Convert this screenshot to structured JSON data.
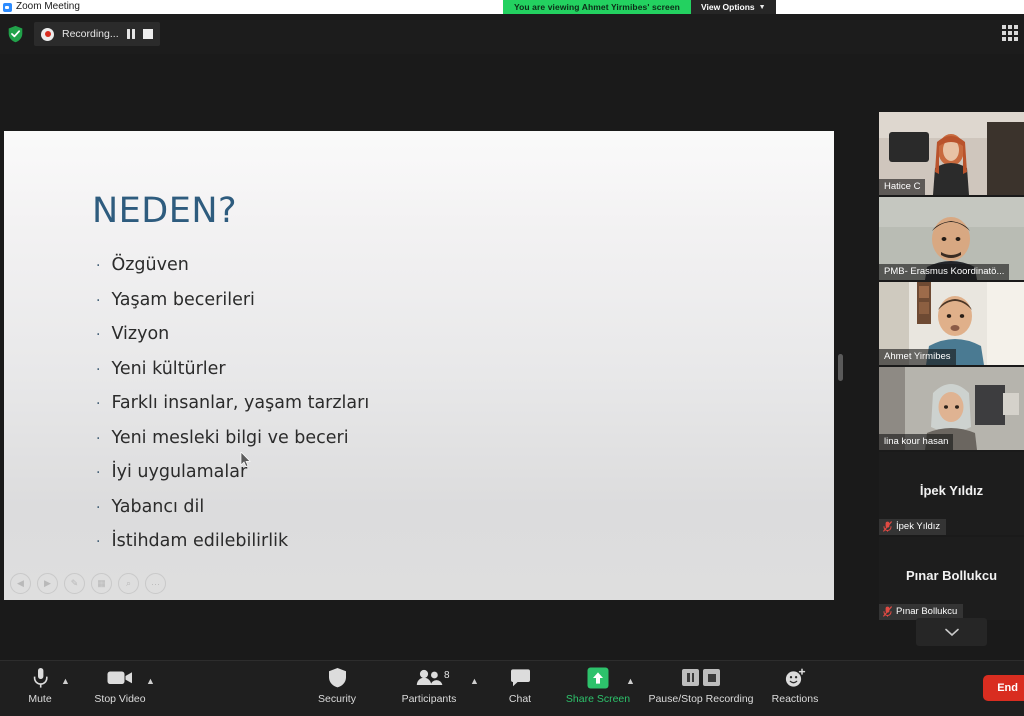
{
  "window": {
    "app_icon": "zoom-icon",
    "title": "Zoom Meeting"
  },
  "share_banner": {
    "viewing_text": "You are viewing Ahmet Yirmibes' screen",
    "view_options_label": "View Options",
    "chevron": "⌄",
    "green_hex": "#23d160"
  },
  "top_bar": {
    "encryption_icon": "green-shield-icon",
    "recording_label": "Recording...",
    "pause_icon": "pause-icon",
    "stop_icon": "stop-icon",
    "gallery_view_icon": "grid-icon"
  },
  "slide": {
    "title": "NEDEN?",
    "title_color": "#2e5c7e",
    "bullet_char": "·",
    "bullets": [
      "Özgüven",
      "Yaşam becerileri",
      "Vizyon",
      "Yeni kültürler",
      "Farklı insanlar, yaşam tarzları",
      "Yeni mesleki bilgi ve beceri",
      "İyi uygulamalar",
      "Yabancı dil",
      "İstihdam edilebilirlik"
    ],
    "controls": [
      {
        "name": "previous-slide-button",
        "glyph": "◀"
      },
      {
        "name": "next-slide-button",
        "glyph": "▶"
      },
      {
        "name": "pen-tool-button",
        "glyph": "✎"
      },
      {
        "name": "all-slides-button",
        "glyph": "▦"
      },
      {
        "name": "zoom-slide-button",
        "glyph": "⌕"
      },
      {
        "name": "more-options-button",
        "glyph": "···"
      }
    ]
  },
  "participants_panel": {
    "video_tiles": [
      {
        "name": "Hatice C",
        "active_speaker": false
      },
      {
        "name": "PMB- Erasmus Koordinatö...",
        "active_speaker": false
      },
      {
        "name": "Ahmet Yirmibes",
        "active_speaker": true
      },
      {
        "name": "lina kour hasan",
        "active_speaker": false
      }
    ],
    "avatar_tiles": [
      {
        "display_name": "İpek Yıldız",
        "name_label": "İpek Yıldız",
        "muted": true
      },
      {
        "display_name": "Pınar Bollukcu",
        "name_label": "Pınar Bollukcu",
        "muted": true
      }
    ],
    "scroll_down_icon": "chevron-down-icon",
    "active_border_hex": "#d5e84e"
  },
  "toolbar": {
    "mute": {
      "label": "Mute",
      "icon": "microphone-icon",
      "has_caret": true
    },
    "video": {
      "label": "Stop Video",
      "icon": "video-camera-icon",
      "has_caret": true
    },
    "security": {
      "label": "Security",
      "icon": "shield-icon"
    },
    "participants": {
      "label": "Participants",
      "icon": "people-icon",
      "count": "8",
      "has_caret": true
    },
    "chat": {
      "label": "Chat",
      "icon": "speech-bubble-icon"
    },
    "share": {
      "label": "Share Screen",
      "icon": "share-arrow-up-icon",
      "has_caret": true,
      "color": "#2dc26b"
    },
    "recording": {
      "label": "Pause/Stop Recording",
      "pause_icon": "pause-icon",
      "stop_icon": "stop-icon"
    },
    "reactions": {
      "label": "Reactions",
      "icon": "smiley-plus-icon"
    },
    "end": {
      "label": "End",
      "color": "#d92d20"
    }
  }
}
